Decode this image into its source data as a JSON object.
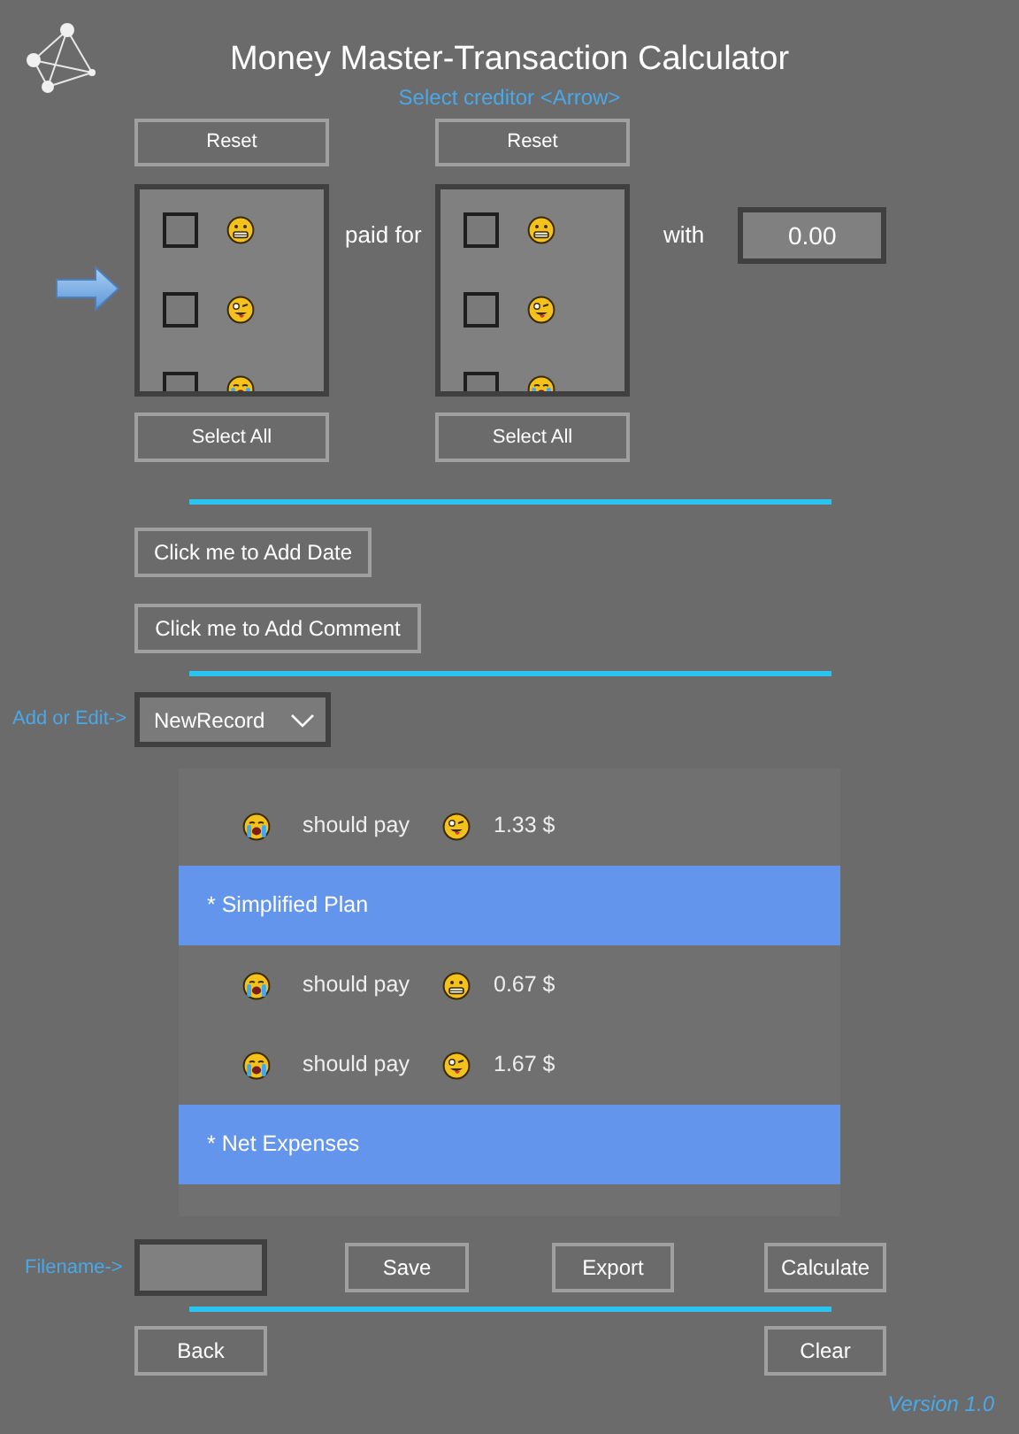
{
  "title": "Money Master-Transaction Calculator",
  "subtitle": "Select creditor <Arrow>",
  "payers": {
    "reset": "Reset",
    "select_all": "Select All",
    "items": [
      {
        "kind": "grimace",
        "checked": false
      },
      {
        "kind": "wink",
        "checked": false
      },
      {
        "kind": "cry",
        "checked": false
      }
    ]
  },
  "connector": "paid for",
  "beneficiaries": {
    "reset": "Reset",
    "select_all": "Select All",
    "items": [
      {
        "kind": "grimace",
        "checked": false
      },
      {
        "kind": "wink",
        "checked": false
      },
      {
        "kind": "cry",
        "checked": false
      }
    ]
  },
  "with_label": "with",
  "amount": "0.00",
  "add_date": "Click me to Add Date",
  "add_comment": "Click me to Add Comment",
  "record_label": "Add or Edit->",
  "record_select": "NewRecord",
  "results": [
    {
      "kind": "payment",
      "from": {
        "kind": "cry"
      },
      "verb": "should pay",
      "to": {
        "kind": "wink"
      },
      "amount": "1.33 $"
    },
    {
      "kind": "header",
      "label": "* Simplified Plan"
    },
    {
      "kind": "payment",
      "from": {
        "kind": "cry"
      },
      "verb": "should pay",
      "to": {
        "kind": "grimace"
      },
      "amount": "0.67 $"
    },
    {
      "kind": "payment",
      "from": {
        "kind": "cry"
      },
      "verb": "should pay",
      "to": {
        "kind": "wink"
      },
      "amount": "1.67 $"
    },
    {
      "kind": "header",
      "label": "* Net Expenses"
    }
  ],
  "filename_label": "Filename->",
  "buttons": {
    "save": "Save",
    "export": "Export",
    "calculate": "Calculate",
    "back": "Back",
    "clear": "Clear"
  },
  "version": "Version 1.0"
}
